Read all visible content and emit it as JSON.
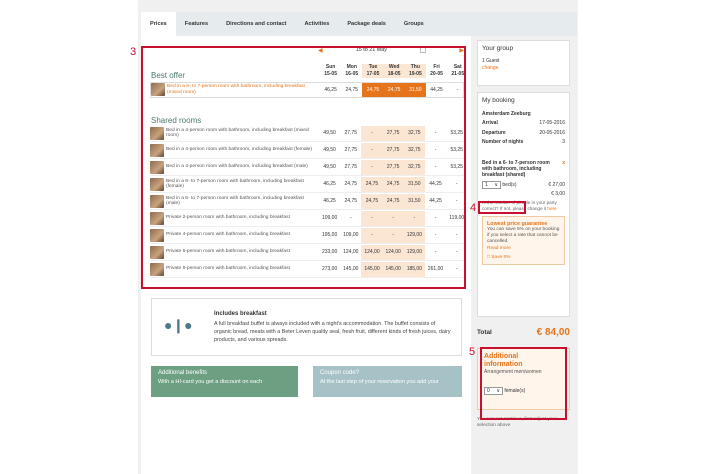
{
  "tabs": [
    {
      "label": "Prices"
    },
    {
      "label": "Features"
    },
    {
      "label": "Directions and contact"
    },
    {
      "label": "Activities"
    },
    {
      "label": "Package deals"
    },
    {
      "label": "Groups"
    }
  ],
  "annotations": {
    "a3": "3",
    "a4": "4",
    "a5": "5"
  },
  "date_nav": {
    "range": "15 to 21 May"
  },
  "days": [
    {
      "dow": "Sun",
      "date": "15-05"
    },
    {
      "dow": "Mon",
      "date": "16-05"
    },
    {
      "dow": "Tue",
      "date": "17-05"
    },
    {
      "dow": "Wed",
      "date": "18-05"
    },
    {
      "dow": "Thu",
      "date": "19-05"
    },
    {
      "dow": "Fri",
      "date": "20-05"
    },
    {
      "dow": "Sat",
      "date": "21-05"
    }
  ],
  "best_offer": {
    "title": "Best offer",
    "rooms": [
      {
        "name": "Bed in a 6- to 7-person room with bathroom, including breakfast (mixed room)",
        "prices": [
          "46,25",
          "24,75",
          "24,75",
          "24,75",
          "31,50",
          "44,25",
          "-"
        ]
      }
    ]
  },
  "shared": {
    "title": "Shared rooms",
    "rooms": [
      {
        "name": "Bed in a 4-person room with bathroom, including breakfast (mixed room)",
        "prices": [
          "49,50",
          "27,75",
          "-",
          "27,75",
          "32,75",
          "-",
          "53,25"
        ]
      },
      {
        "name": "Bed in a 4-person room with bathroom, including breakfast (female)",
        "prices": [
          "49,50",
          "27,75",
          "-",
          "27,75",
          "32,75",
          "-",
          "53,25"
        ]
      },
      {
        "name": "Bed in a 4-person room with bathroom, including breakfast (male)",
        "prices": [
          "49,50",
          "27,75",
          "-",
          "27,75",
          "32,75",
          "-",
          "53,25"
        ]
      },
      {
        "name": "Bed in a 6- to 7-person room with bathroom, including breakfast (female)",
        "prices": [
          "46,25",
          "24,75",
          "24,75",
          "24,75",
          "31,50",
          "44,25",
          "-"
        ]
      },
      {
        "name": "Bed in a 6- to 7-person room with bathroom, including breakfast (male)",
        "prices": [
          "46,25",
          "24,75",
          "24,75",
          "24,75",
          "31,50",
          "44,25",
          "-"
        ]
      },
      {
        "name": "Private 2-person room with bathroom, including breakfast",
        "prices": [
          "109,00",
          "-",
          "-",
          "-",
          "-",
          "-",
          "119,00"
        ]
      },
      {
        "name": "Private 4-person room with bathroom, including breakfast",
        "prices": [
          "195,00",
          "109,00",
          "-",
          "-",
          "129,00",
          "-",
          "-"
        ]
      },
      {
        "name": "Private 5-person room with bathroom, including breakfast",
        "prices": [
          "233,00",
          "124,00",
          "124,00",
          "124,00",
          "129,00",
          "-",
          "-"
        ]
      },
      {
        "name": "Private 6-person room with bathroom, including breakfast",
        "prices": [
          "273,00",
          "145,00",
          "145,00",
          "145,00",
          "185,00",
          "261,00",
          "-"
        ]
      }
    ]
  },
  "includes": {
    "title": "Includes breakfast",
    "text": "A full breakfast buffet is always included with a night's accommodation. The buffet consists of organic bread, meats with a Beter Leven quality seal, fresh fruit, different kinds of fresh juices, dairy products, and various spreads."
  },
  "banners": {
    "benefits_title": "Additional benefits",
    "benefits_text": "With a HI-card you get a discount on each",
    "coupon_title": "Coupon code?",
    "coupon_text": "At the last step of your reservation you add your"
  },
  "group": {
    "title": "Your group",
    "guests": "1 Guest",
    "change": "change"
  },
  "booking": {
    "title": "My booking",
    "hostel": "Amsterdam Zeeburg",
    "arrival_label": "Arrival",
    "arrival": "17-05-2016",
    "departure_label": "Departure",
    "departure": "20-05-2016",
    "nights_label": "Number of nights",
    "nights": "3",
    "room": "Bed in a 6- to 7-person room with bathroom, including breakfast (shared)",
    "remove": "x",
    "qty": "1",
    "qty_unit": "bed(s)",
    "price1": "€ 27,00",
    "price2": "€ 3,00",
    "note": "Is the number of people in your party correct? If not, please change it",
    "note_link": "here",
    "lpg_title": "Lowest price guarantee",
    "lpg_text": "You can save 5% on your booking if you select a rate that cannot be cancelled.",
    "read_more": "Read more",
    "save": "Save 5%"
  },
  "total": {
    "label": "Total",
    "value": "€ 84,00"
  },
  "additional": {
    "title": "Additional information",
    "sub": "Arrangement men/women",
    "female_qty": "0",
    "female_label": "female(s)"
  },
  "footer_note": "You can not continue, first adjust your selection above",
  "colors": {
    "accent": "#e5741b",
    "annotation": "#c8102e",
    "green": "#6d9f83",
    "teal": "#a6c2c7"
  }
}
